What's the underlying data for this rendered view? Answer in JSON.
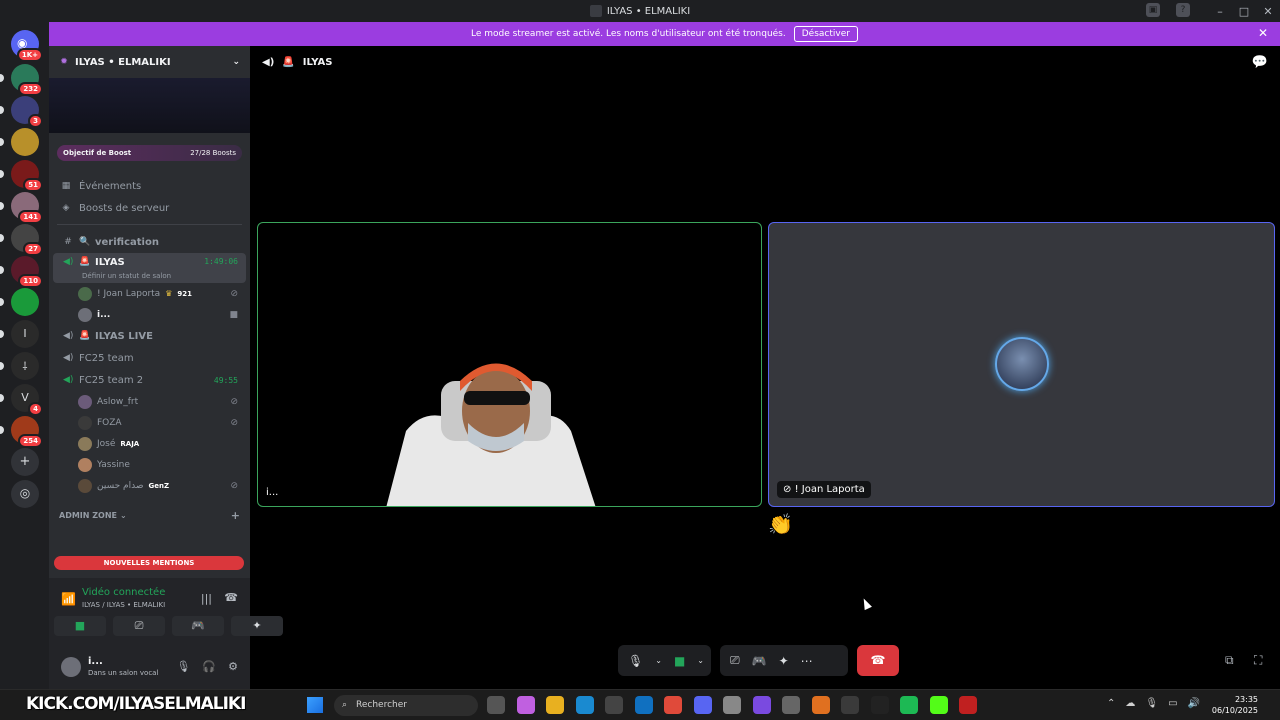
{
  "window": {
    "title": "ILYAS • ELMALIKI"
  },
  "banner": {
    "message": "Le mode streamer est activé. Les noms d'utilisateur ont été tronqués.",
    "button": "Désactiver"
  },
  "guilds": {
    "home_badge": "1K+",
    "items": [
      {
        "badge": "232",
        "color": "#2a7a5a"
      },
      {
        "badge": "3",
        "color": "#3b3f7a"
      },
      {
        "badge": "",
        "color": "#b8902a"
      },
      {
        "badge": "51",
        "color": "#7a1a1a"
      },
      {
        "badge": "141",
        "color": "#8a6a7a"
      },
      {
        "badge": "27",
        "color": "#444"
      },
      {
        "badge": "110",
        "color": "#5a1a2a"
      },
      {
        "badge": "",
        "color": "#1a9a3a"
      },
      {
        "badge": "",
        "color": "#2a2a2a",
        "letter": "I"
      },
      {
        "badge": "",
        "color": "#2a2a2a",
        "letter": "⸸"
      },
      {
        "badge": "4",
        "color": "#2a2a2a",
        "letter": "V"
      },
      {
        "badge": "254",
        "color": "#a03a1a"
      }
    ]
  },
  "sidebar": {
    "server_name": "ILYAS • ELMALIKI",
    "boost": {
      "label": "Objectif de Boost",
      "count": "27/28 Boosts"
    },
    "links": [
      {
        "label": "Événements",
        "icon": "calendar-icon"
      },
      {
        "label": "Boosts de serveur",
        "icon": "boost-icon"
      }
    ],
    "channels": {
      "verification": "verification",
      "ilyas": {
        "name": "ILYAS",
        "time": "1:49:06",
        "status": "Définir un statut de salon"
      },
      "ilyas_members": [
        {
          "name": "! Joan Laporta",
          "tag": "921"
        },
        {
          "name": "i..."
        }
      ],
      "ilyas_live": "ILYAS LIVE",
      "fc25": "FC25 team",
      "fc25_2": {
        "name": "FC25 team 2",
        "time": "49:55"
      },
      "fc25_2_members": [
        {
          "name": "Aslow_frt",
          "tag": "",
          "av": "#6b5b7a"
        },
        {
          "name": "FOZA",
          "tag": "",
          "av": "#3a3a3a"
        },
        {
          "name": "José",
          "tag": "RAJA",
          "av": "#8a7a5a"
        },
        {
          "name": "Yassine",
          "tag": "",
          "av": "#b08060"
        },
        {
          "name": "صدام حسين",
          "tag": "GenZ",
          "av": "#5a4a3a"
        }
      ]
    },
    "category_admin": "ADMIN ZONE",
    "mentions": "NOUVELLES MENTIONS",
    "voice": {
      "title": "Vidéo connectée",
      "subtitle": "ILYAS / ILYAS • ELMALIKI"
    },
    "user": {
      "name": "i...",
      "status": "Dans un salon vocal"
    }
  },
  "call": {
    "channel": "ILYAS",
    "tile_a_label": "i...",
    "tile_b_label": "! Joan Laporta"
  },
  "taskbar": {
    "kick": "KICK.COM/ILYASELMALIKI",
    "search_placeholder": "Rechercher",
    "time": "23:35",
    "date": "06/10/2025"
  },
  "colors": {
    "banner": "#9b3de0",
    "speaking": "#3ba55c",
    "hangup": "#da373c"
  }
}
